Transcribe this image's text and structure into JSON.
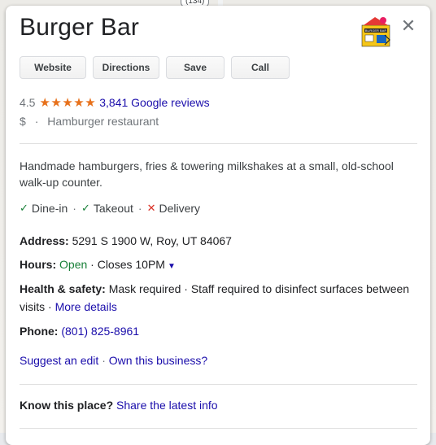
{
  "map": {
    "road_shield": "(134)"
  },
  "place": {
    "name": "Burger Bar",
    "logo_text": "BURGER BAR",
    "close_icon": "close-icon"
  },
  "buttons": {
    "website": "Website",
    "directions": "Directions",
    "save": "Save",
    "call": "Call"
  },
  "rating": {
    "score": "4.5",
    "stars": "★★★★★",
    "stars_value": 4.5,
    "reviews_link": "3,841 Google reviews"
  },
  "category": {
    "price": "$",
    "separator": "·",
    "type": "Hamburger restaurant"
  },
  "description": "Handmade hamburgers, fries & towering milkshakes at a small, old-school walk-up counter.",
  "service_options": {
    "dine_in": "Dine-in",
    "takeout": "Takeout",
    "delivery": "Delivery",
    "check_glyph": "✓",
    "cross_glyph": "✕",
    "separator": "·"
  },
  "details": {
    "address_label": "Address:",
    "address_value": "5291 S 1900 W, Roy, UT 84067",
    "hours_label": "Hours:",
    "hours_status": "Open",
    "hours_closes": "· Closes 10PM",
    "health_label": "Health & safety:",
    "health_value": "Mask required · Staff required to disinfect surfaces between visits ·",
    "health_link": "More details",
    "phone_label": "Phone:",
    "phone_value": "(801) 825-8961"
  },
  "footer": {
    "suggest_edit": "Suggest an edit",
    "separator": "·",
    "own_business": "Own this business?",
    "know_label": "Know this place?",
    "share_link": "Share the latest info"
  },
  "colors": {
    "star": "#e7711b",
    "link": "#1a0dab",
    "open": "#188038",
    "cross": "#d93025"
  }
}
